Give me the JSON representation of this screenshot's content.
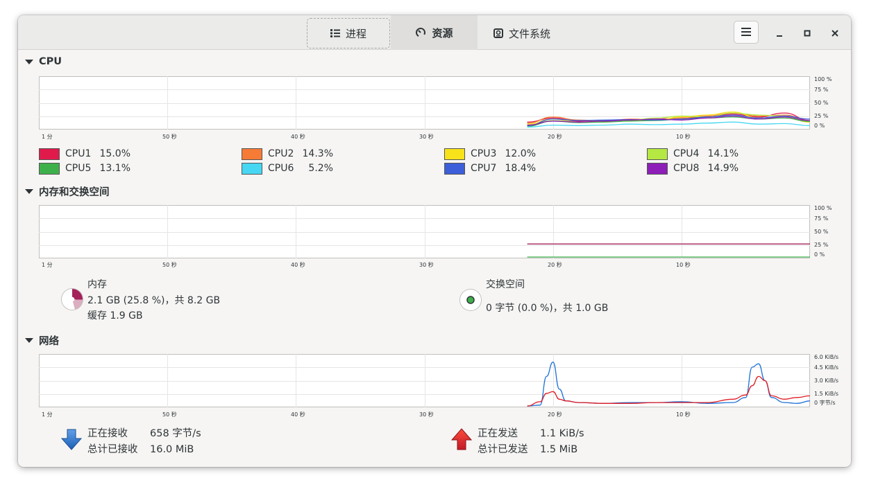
{
  "header": {
    "tabs": [
      {
        "label": "进程",
        "icon": "list-icon"
      },
      {
        "label": "资源",
        "icon": "gauge-icon"
      },
      {
        "label": "文件系统",
        "icon": "disk-icon"
      }
    ],
    "active_tab": "资源"
  },
  "sections": {
    "cpu": "CPU",
    "memory": "内存和交换空间",
    "network": "网络"
  },
  "axis": {
    "x_ticks": [
      "1 分",
      "50 秒",
      "40 秒",
      "30 秒",
      "20 秒",
      "10 秒"
    ],
    "pct_ticks": [
      "100 %",
      "75 %",
      "50 %",
      "25 %",
      "0 %"
    ],
    "net_ticks": [
      "6.0 KiB/s",
      "4.5 KiB/s",
      "3.0 KiB/s",
      "1.5 KiB/s",
      "0 字节/s"
    ]
  },
  "cpus": [
    {
      "name": "CPU1",
      "value": "15.0%",
      "color": "#e01b4c"
    },
    {
      "name": "CPU2",
      "value": "14.3%",
      "color": "#f57b36"
    },
    {
      "name": "CPU3",
      "value": "12.0%",
      "color": "#f8e21a"
    },
    {
      "name": "CPU4",
      "value": "14.1%",
      "color": "#b5e843"
    },
    {
      "name": "CPU5",
      "value": "13.1%",
      "color": "#3eb04a"
    },
    {
      "name": "CPU6",
      "value": "5.2%",
      "color": "#47d7f3"
    },
    {
      "name": "CPU7",
      "value": "18.4%",
      "color": "#3c5ed9"
    },
    {
      "name": "CPU8",
      "value": "14.9%",
      "color": "#8d1eb8"
    }
  ],
  "memory": {
    "label": "内存",
    "usage": "2.1 GB (25.8 %)，共 8.2 GB",
    "cache": "缓存 1.9 GB",
    "color": "#a4215a"
  },
  "swap": {
    "label": "交换空间",
    "usage": "0 字节 (0.0 %)，共 1.0 GB",
    "color": "#3eb04a"
  },
  "network": {
    "receiving_label": "正在接收",
    "receiving_value": "658 字节/s",
    "total_received_label": "总计已接收",
    "total_received_value": "16.0 MiB",
    "sending_label": "正在发送",
    "sending_value": "1.1 KiB/s",
    "total_sent_label": "总计已发送",
    "total_sent_value": "1.5 MiB",
    "recv_color": "#1c71d8",
    "send_color": "#e01b24"
  },
  "chart_data": [
    {
      "type": "line",
      "ylim": [
        0,
        100
      ],
      "xlim": [
        60,
        0
      ],
      "x": [
        22,
        20,
        18,
        16,
        14,
        12,
        10,
        8,
        6,
        4,
        2,
        0
      ],
      "series": [
        {
          "name": "CPU1",
          "values": [
            12,
            20,
            14,
            15,
            16,
            18,
            20,
            22,
            28,
            22,
            30,
            15
          ]
        },
        {
          "name": "CPU2",
          "values": [
            10,
            22,
            16,
            14,
            18,
            17,
            20,
            24,
            30,
            24,
            26,
            14
          ]
        },
        {
          "name": "CPU3",
          "values": [
            8,
            18,
            12,
            13,
            15,
            16,
            22,
            26,
            32,
            20,
            22,
            12
          ]
        },
        {
          "name": "CPU4",
          "values": [
            6,
            15,
            12,
            12,
            16,
            20,
            24,
            22,
            30,
            26,
            24,
            14
          ]
        },
        {
          "name": "CPU5",
          "values": [
            4,
            14,
            11,
            12,
            14,
            15,
            18,
            20,
            22,
            18,
            20,
            13
          ]
        },
        {
          "name": "CPU6",
          "values": [
            2,
            6,
            5,
            6,
            8,
            7,
            8,
            10,
            12,
            8,
            9,
            5
          ]
        },
        {
          "name": "CPU7",
          "values": [
            5,
            18,
            15,
            16,
            17,
            16,
            18,
            22,
            26,
            20,
            24,
            18
          ]
        },
        {
          "name": "CPU8",
          "values": [
            6,
            14,
            12,
            14,
            16,
            18,
            16,
            20,
            24,
            18,
            22,
            15
          ]
        }
      ]
    },
    {
      "type": "line",
      "ylim": [
        0,
        100
      ],
      "xlim": [
        60,
        0
      ],
      "x": [
        22,
        0
      ],
      "series": [
        {
          "name": "内存",
          "values": [
            25.8,
            25.8
          ]
        },
        {
          "name": "交换空间",
          "values": [
            0,
            0
          ]
        }
      ]
    },
    {
      "type": "line",
      "ylim": [
        0,
        6.0
      ],
      "xlim": [
        60,
        0
      ],
      "x": [
        22,
        21,
        20.5,
        20,
        19.5,
        19,
        18,
        16,
        14,
        12,
        10,
        8,
        6,
        5,
        4.5,
        4,
        3.5,
        3,
        2,
        1,
        0
      ],
      "series": [
        {
          "name": "正在接收",
          "values": [
            0,
            0.1,
            3.5,
            5.2,
            2.0,
            0.6,
            0.4,
            0.3,
            0.4,
            0.4,
            0.5,
            0.3,
            0.4,
            1.0,
            4.6,
            5.0,
            3.0,
            1.0,
            0.4,
            0.3,
            0.6
          ]
        },
        {
          "name": "正在发送",
          "values": [
            0,
            0.5,
            1.5,
            1.7,
            0.8,
            0.6,
            0.4,
            0.3,
            0.3,
            0.4,
            0.4,
            0.4,
            0.8,
            1.3,
            2.4,
            3.5,
            3.0,
            1.2,
            0.8,
            1.0,
            1.2
          ]
        }
      ]
    }
  ]
}
